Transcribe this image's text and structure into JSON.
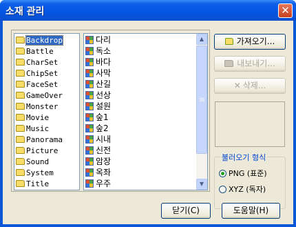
{
  "window": {
    "title": "소재 관리",
    "close_glyph": "✕"
  },
  "folders": [
    {
      "label": "Backdrop",
      "selected": true
    },
    {
      "label": "Battle"
    },
    {
      "label": "CharSet"
    },
    {
      "label": "ChipSet"
    },
    {
      "label": "FaceSet"
    },
    {
      "label": "GameOver"
    },
    {
      "label": "Monster"
    },
    {
      "label": "Movie"
    },
    {
      "label": "Music"
    },
    {
      "label": "Panorama"
    },
    {
      "label": "Picture"
    },
    {
      "label": "Sound"
    },
    {
      "label": "System"
    },
    {
      "label": "Title"
    }
  ],
  "files": [
    "다리",
    "독소",
    "바다",
    "사막",
    "산길",
    "선상",
    "설원",
    "숲1",
    "숲2",
    "시내",
    "신전",
    "암장",
    "옥좌",
    "우주"
  ],
  "buttons": {
    "import_label": "가져오기...",
    "export_label": "내보내기...",
    "delete_label": "삭제...",
    "close_label": "닫기(C)",
    "help_label": "도움말(H)"
  },
  "import_mode": {
    "legend": "불러오기 형식",
    "options": [
      {
        "label": "PNG (표준)",
        "selected": true
      },
      {
        "label": "XYZ (독자)",
        "selected": false
      }
    ]
  },
  "icons": {
    "folder": "folder-icon",
    "file": "image-file-icon",
    "close": "close-icon"
  }
}
